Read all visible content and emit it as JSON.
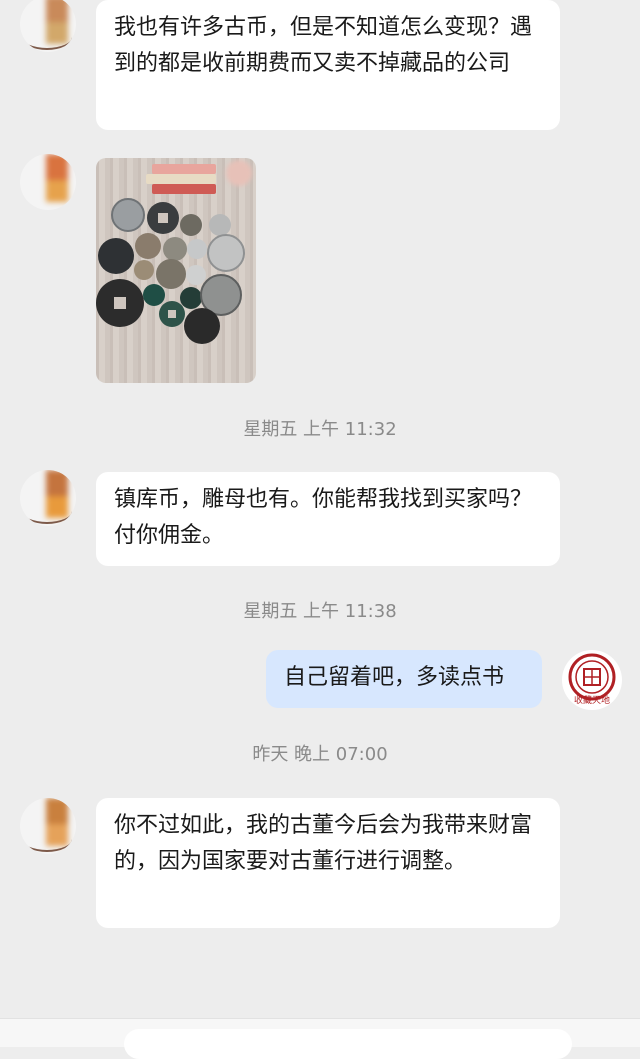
{
  "messages": [
    {
      "from": "other",
      "text": "我也有许多古币，但是不知道怎么变现？遇到的都是收前期费而又卖不掉藏品的公司"
    },
    {
      "from": "other",
      "type": "image",
      "image_desc": "coins-photo"
    },
    {
      "from": "other",
      "text": "镇库币，雕母也有。你能帮我找到买家吗？付你佣金。"
    },
    {
      "from": "self",
      "text": "自己留着吧，多读点书"
    },
    {
      "from": "other",
      "text": "你不过如此，我的古董今后会为我带来财富的，因为国家要对古董行进行调整。"
    }
  ],
  "timestamps": [
    "星期五 上午 11:32",
    "星期五 上午 11:38",
    "昨天 晚上 07:00"
  ],
  "self_avatar": {
    "caption": "收藏天地"
  },
  "colors": {
    "background": "#ededed",
    "bubble_other": "#ffffff",
    "bubble_self": "#d7e7fe",
    "seal_red": "#b02024"
  }
}
